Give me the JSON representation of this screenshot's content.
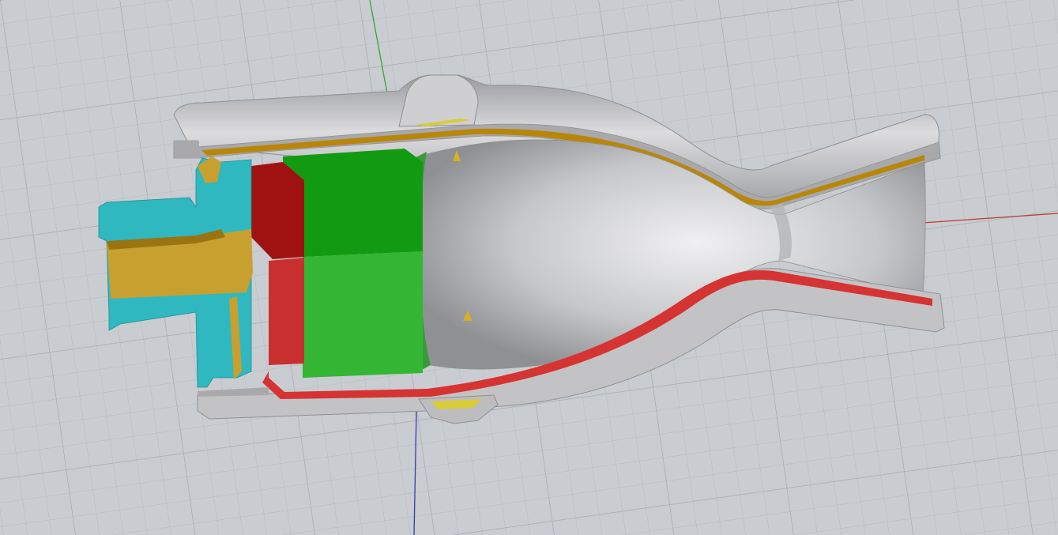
{
  "viewport": {
    "name": "3D section view",
    "colors": {
      "background": "#c9ccd0",
      "grid_minor": "#b9bdc2",
      "grid_major": "#a9aeb4",
      "axis_x": "#c0392b",
      "axis_y": "#3aa33a",
      "axis_z": "#3a3aa8",
      "shell": "#c4c4c6",
      "shell_edge": "#8f9094",
      "cut_face": "#a8a8aa",
      "coolant_upper": "#b8860b",
      "coolant_lower": "#d63333",
      "injector": "#2fb8c0",
      "fuel_core": "#c8a030",
      "seal_upper": "#a01212",
      "seal_lower": "#c83030",
      "chamber_upper": "#139a13",
      "chamber_lower": "#34b534",
      "yellow_pad": "#d8cc3a"
    }
  }
}
